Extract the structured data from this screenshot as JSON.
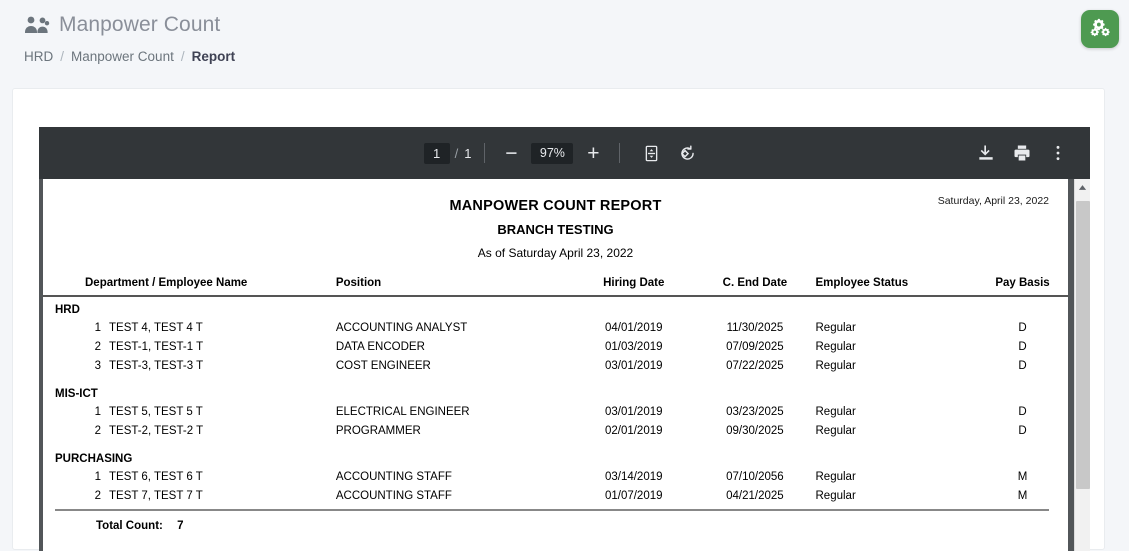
{
  "header": {
    "title": "Manpower Count",
    "icon": "people-group-icon",
    "breadcrumb": [
      {
        "label": "HRD",
        "active": false
      },
      {
        "label": "Manpower Count",
        "active": false
      },
      {
        "label": "Report",
        "active": true
      }
    ],
    "separator": "/"
  },
  "fab": {
    "name": "settings-gears-button",
    "icon": "gears-icon",
    "color": "#4e9a51"
  },
  "pdf_toolbar": {
    "menu_icon": "hamburger-menu-icon",
    "page_current": "1",
    "page_separator": "/",
    "page_total": "1",
    "zoom_out_label": "−",
    "zoom_level": "97%",
    "zoom_in_label": "+",
    "fit_icon": "fit-to-page-icon",
    "rotate_icon": "rotate-icon",
    "download_icon": "download-icon",
    "print_icon": "print-icon",
    "more_icon": "more-options-icon",
    "background": "#323639"
  },
  "document": {
    "date_stamp": "Saturday, April 23, 2022",
    "title": "MANPOWER COUNT REPORT",
    "subtitle": "BRANCH TESTING",
    "as_of": "As of Saturday April 23, 2022",
    "columns": [
      "Department / Employee Name",
      "Position",
      "Hiring Date",
      "C. End Date",
      "Employee Status",
      "Pay Basis"
    ],
    "sections": [
      {
        "department": "HRD",
        "rows": [
          {
            "num": "1",
            "name": "TEST 4, TEST 4 T",
            "position": "ACCOUNTING ANALYST",
            "hiring_date": "04/01/2019",
            "end_date": "11/30/2025",
            "status": "Regular",
            "pay_basis": "D"
          },
          {
            "num": "2",
            "name": "TEST-1, TEST-1 T",
            "position": "DATA ENCODER",
            "hiring_date": "01/03/2019",
            "end_date": "07/09/2025",
            "status": "Regular",
            "pay_basis": "D"
          },
          {
            "num": "3",
            "name": "TEST-3, TEST-3 T",
            "position": "COST ENGINEER",
            "hiring_date": "03/01/2019",
            "end_date": "07/22/2025",
            "status": "Regular",
            "pay_basis": "D"
          }
        ]
      },
      {
        "department": "MIS-ICT",
        "rows": [
          {
            "num": "1",
            "name": "TEST 5, TEST 5 T",
            "position": "ELECTRICAL ENGINEER",
            "hiring_date": "03/01/2019",
            "end_date": "03/23/2025",
            "status": "Regular",
            "pay_basis": "D"
          },
          {
            "num": "2",
            "name": "TEST-2, TEST-2 T",
            "position": "PROGRAMMER",
            "hiring_date": "02/01/2019",
            "end_date": "09/30/2025",
            "status": "Regular",
            "pay_basis": "D"
          }
        ]
      },
      {
        "department": "PURCHASING",
        "rows": [
          {
            "num": "1",
            "name": "TEST 6, TEST 6 T",
            "position": "ACCOUNTING STAFF",
            "hiring_date": "03/14/2019",
            "end_date": "07/10/2056",
            "status": "Regular",
            "pay_basis": "M"
          },
          {
            "num": "2",
            "name": "TEST 7, TEST 7 T",
            "position": "ACCOUNTING STAFF",
            "hiring_date": "01/07/2019",
            "end_date": "04/21/2025",
            "status": "Regular",
            "pay_basis": "M"
          }
        ]
      }
    ],
    "total_label": "Total Count:",
    "total_value": "7"
  }
}
